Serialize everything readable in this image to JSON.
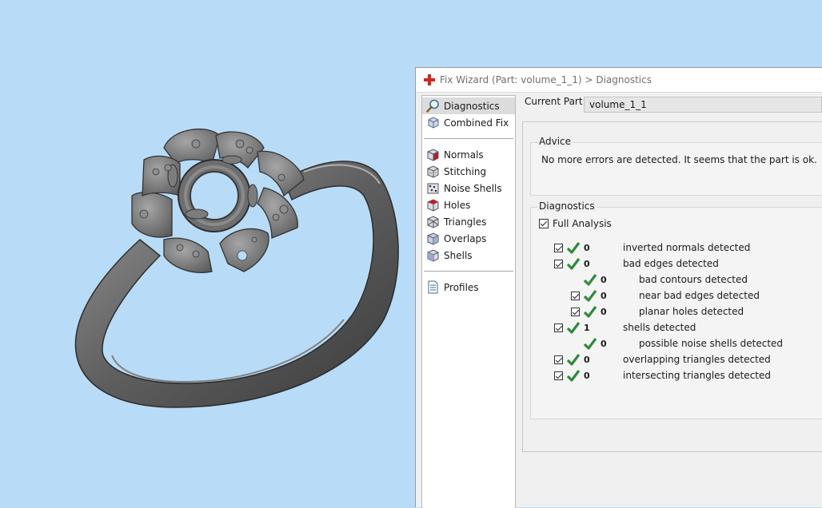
{
  "dialog": {
    "title": "Fix Wizard (Part: volume_1_1) > Diagnostics",
    "current_part_label": "Current Part:",
    "current_part_value": "volume_1_1"
  },
  "nav": {
    "top": [
      {
        "label": "Diagnostics",
        "icon": "magnifier-icon",
        "selected": true
      },
      {
        "label": "Combined Fix",
        "icon": "combined-fix-icon"
      }
    ],
    "fixes": [
      {
        "label": "Normals",
        "icon": "normals-cube-icon"
      },
      {
        "label": "Stitching",
        "icon": "stitching-cube-icon"
      },
      {
        "label": "Noise Shells",
        "icon": "noise-shells-icon"
      },
      {
        "label": "Holes",
        "icon": "holes-cube-icon"
      },
      {
        "label": "Triangles",
        "icon": "triangles-cube-icon"
      },
      {
        "label": "Overlaps",
        "icon": "overlaps-cube-icon"
      },
      {
        "label": "Shells",
        "icon": "shells-cube-icon"
      }
    ],
    "bottom": [
      {
        "label": "Profiles",
        "icon": "profiles-document-icon"
      }
    ]
  },
  "advice": {
    "legend": "Advice",
    "text": "No more errors are detected. It seems that the part is ok."
  },
  "diagnostics": {
    "legend": "Diagnostics",
    "full_analysis_label": "Full Analysis",
    "rows": [
      {
        "count": "0",
        "label": "inverted normals detected",
        "level": 0,
        "checkbox": true
      },
      {
        "count": "0",
        "label": "bad edges detected",
        "level": 0,
        "checkbox": true
      },
      {
        "count": "0",
        "label": "bad contours detected",
        "level": 1,
        "checkbox": false
      },
      {
        "count": "0",
        "label": "near bad edges detected",
        "level": 1,
        "checkbox": true
      },
      {
        "count": "0",
        "label": "planar holes detected",
        "level": 1,
        "checkbox": true
      },
      {
        "count": "1",
        "label": "shells detected",
        "level": 0,
        "checkbox": true
      },
      {
        "count": "0",
        "label": "possible noise shells detected",
        "level": 1,
        "checkbox": false
      },
      {
        "count": "0",
        "label": "overlapping triangles detected",
        "level": 0,
        "checkbox": true
      },
      {
        "count": "0",
        "label": "intersecting triangles detected",
        "level": 0,
        "checkbox": true
      }
    ]
  },
  "colors": {
    "viewport_bg": "#b8dcf7",
    "check_green": "#2e8b3a",
    "app_icon_red": "#d9241c"
  }
}
